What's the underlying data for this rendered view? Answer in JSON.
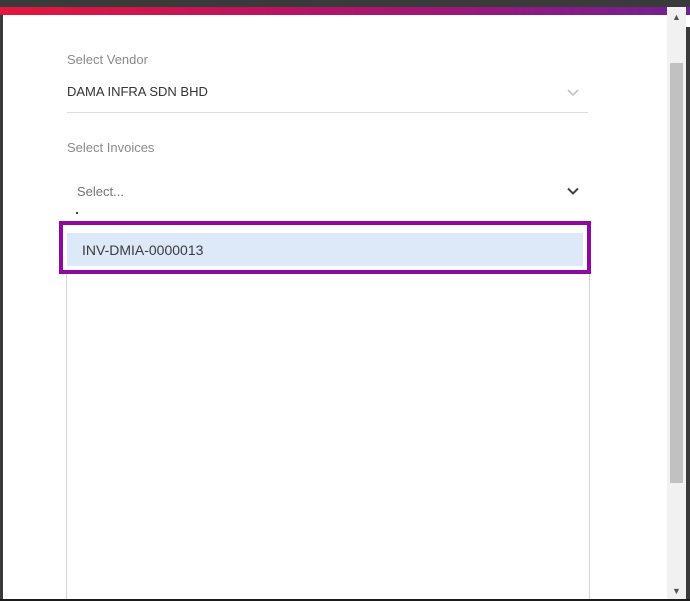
{
  "vendor": {
    "label": "Select Vendor",
    "value": "DAMA INFRA SDN BHD",
    "icon": "chevron-down-icon"
  },
  "invoices": {
    "label": "Select Invoices",
    "placeholder": "Select...",
    "icon": "chevron-down-icon",
    "options": [
      {
        "label": "INV-DMIA-0000013",
        "highlighted": true
      }
    ]
  },
  "colors": {
    "highlight_border": "#8e09a0",
    "option_background": "#dde9f8",
    "gradient_start": "#e3173a",
    "gradient_end": "#6f2291"
  }
}
